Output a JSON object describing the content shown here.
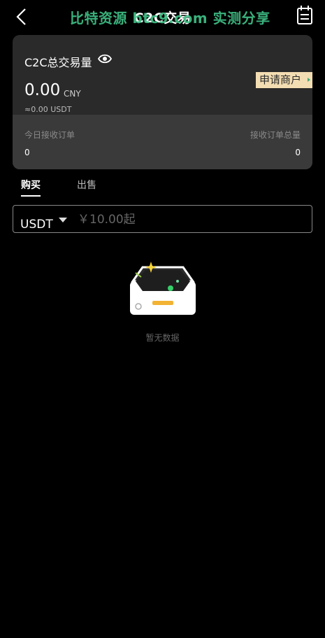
{
  "header": {
    "title": "C2C交易",
    "watermark": "比特资源 btc9.com 实测分享"
  },
  "summary": {
    "title": "C2C总交易量",
    "amount": "0.00",
    "currency": "CNY",
    "usdt_equivalent": "≈0.00 USDT",
    "apply_merchant_label": "申请商户",
    "today_orders_label": "今日接收订单",
    "today_orders_value": "0",
    "total_orders_label": "接收订单总量",
    "total_orders_value": "0"
  },
  "tabs": [
    {
      "label": "购买",
      "active": true
    },
    {
      "label": "出售",
      "active": false
    }
  ],
  "filter": {
    "currency": "USDT",
    "amount_placeholder": "￥10.00起"
  },
  "empty_state": {
    "text": "暂无数据"
  },
  "colors": {
    "accent_gold": "#f3ddb2",
    "watermark_green": "#3fbf86"
  }
}
